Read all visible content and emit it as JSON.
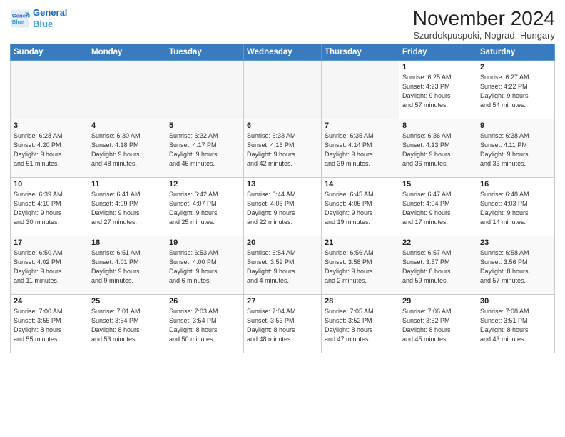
{
  "header": {
    "logo_line1": "General",
    "logo_line2": "Blue",
    "month_title": "November 2024",
    "subtitle": "Szurdokpuspoki, Nograd, Hungary"
  },
  "days_of_week": [
    "Sunday",
    "Monday",
    "Tuesday",
    "Wednesday",
    "Thursday",
    "Friday",
    "Saturday"
  ],
  "weeks": [
    [
      {
        "day": "",
        "info": ""
      },
      {
        "day": "",
        "info": ""
      },
      {
        "day": "",
        "info": ""
      },
      {
        "day": "",
        "info": ""
      },
      {
        "day": "",
        "info": ""
      },
      {
        "day": "1",
        "info": "Sunrise: 6:25 AM\nSunset: 4:23 PM\nDaylight: 9 hours\nand 57 minutes."
      },
      {
        "day": "2",
        "info": "Sunrise: 6:27 AM\nSunset: 4:22 PM\nDaylight: 9 hours\nand 54 minutes."
      }
    ],
    [
      {
        "day": "3",
        "info": "Sunrise: 6:28 AM\nSunset: 4:20 PM\nDaylight: 9 hours\nand 51 minutes."
      },
      {
        "day": "4",
        "info": "Sunrise: 6:30 AM\nSunset: 4:18 PM\nDaylight: 9 hours\nand 48 minutes."
      },
      {
        "day": "5",
        "info": "Sunrise: 6:32 AM\nSunset: 4:17 PM\nDaylight: 9 hours\nand 45 minutes."
      },
      {
        "day": "6",
        "info": "Sunrise: 6:33 AM\nSunset: 4:16 PM\nDaylight: 9 hours\nand 42 minutes."
      },
      {
        "day": "7",
        "info": "Sunrise: 6:35 AM\nSunset: 4:14 PM\nDaylight: 9 hours\nand 39 minutes."
      },
      {
        "day": "8",
        "info": "Sunrise: 6:36 AM\nSunset: 4:13 PM\nDaylight: 9 hours\nand 36 minutes."
      },
      {
        "day": "9",
        "info": "Sunrise: 6:38 AM\nSunset: 4:11 PM\nDaylight: 9 hours\nand 33 minutes."
      }
    ],
    [
      {
        "day": "10",
        "info": "Sunrise: 6:39 AM\nSunset: 4:10 PM\nDaylight: 9 hours\nand 30 minutes."
      },
      {
        "day": "11",
        "info": "Sunrise: 6:41 AM\nSunset: 4:09 PM\nDaylight: 9 hours\nand 27 minutes."
      },
      {
        "day": "12",
        "info": "Sunrise: 6:42 AM\nSunset: 4:07 PM\nDaylight: 9 hours\nand 25 minutes."
      },
      {
        "day": "13",
        "info": "Sunrise: 6:44 AM\nSunset: 4:06 PM\nDaylight: 9 hours\nand 22 minutes."
      },
      {
        "day": "14",
        "info": "Sunrise: 6:45 AM\nSunset: 4:05 PM\nDaylight: 9 hours\nand 19 minutes."
      },
      {
        "day": "15",
        "info": "Sunrise: 6:47 AM\nSunset: 4:04 PM\nDaylight: 9 hours\nand 17 minutes."
      },
      {
        "day": "16",
        "info": "Sunrise: 6:48 AM\nSunset: 4:03 PM\nDaylight: 9 hours\nand 14 minutes."
      }
    ],
    [
      {
        "day": "17",
        "info": "Sunrise: 6:50 AM\nSunset: 4:02 PM\nDaylight: 9 hours\nand 11 minutes."
      },
      {
        "day": "18",
        "info": "Sunrise: 6:51 AM\nSunset: 4:01 PM\nDaylight: 9 hours\nand 9 minutes."
      },
      {
        "day": "19",
        "info": "Sunrise: 6:53 AM\nSunset: 4:00 PM\nDaylight: 9 hours\nand 6 minutes."
      },
      {
        "day": "20",
        "info": "Sunrise: 6:54 AM\nSunset: 3:59 PM\nDaylight: 9 hours\nand 4 minutes."
      },
      {
        "day": "21",
        "info": "Sunrise: 6:56 AM\nSunset: 3:58 PM\nDaylight: 9 hours\nand 2 minutes."
      },
      {
        "day": "22",
        "info": "Sunrise: 6:57 AM\nSunset: 3:57 PM\nDaylight: 8 hours\nand 59 minutes."
      },
      {
        "day": "23",
        "info": "Sunrise: 6:58 AM\nSunset: 3:56 PM\nDaylight: 8 hours\nand 57 minutes."
      }
    ],
    [
      {
        "day": "24",
        "info": "Sunrise: 7:00 AM\nSunset: 3:55 PM\nDaylight: 8 hours\nand 55 minutes."
      },
      {
        "day": "25",
        "info": "Sunrise: 7:01 AM\nSunset: 3:54 PM\nDaylight: 8 hours\nand 53 minutes."
      },
      {
        "day": "26",
        "info": "Sunrise: 7:03 AM\nSunset: 3:54 PM\nDaylight: 8 hours\nand 50 minutes."
      },
      {
        "day": "27",
        "info": "Sunrise: 7:04 AM\nSunset: 3:53 PM\nDaylight: 8 hours\nand 48 minutes."
      },
      {
        "day": "28",
        "info": "Sunrise: 7:05 AM\nSunset: 3:52 PM\nDaylight: 8 hours\nand 47 minutes."
      },
      {
        "day": "29",
        "info": "Sunrise: 7:06 AM\nSunset: 3:52 PM\nDaylight: 8 hours\nand 45 minutes."
      },
      {
        "day": "30",
        "info": "Sunrise: 7:08 AM\nSunset: 3:51 PM\nDaylight: 8 hours\nand 43 minutes."
      }
    ]
  ]
}
